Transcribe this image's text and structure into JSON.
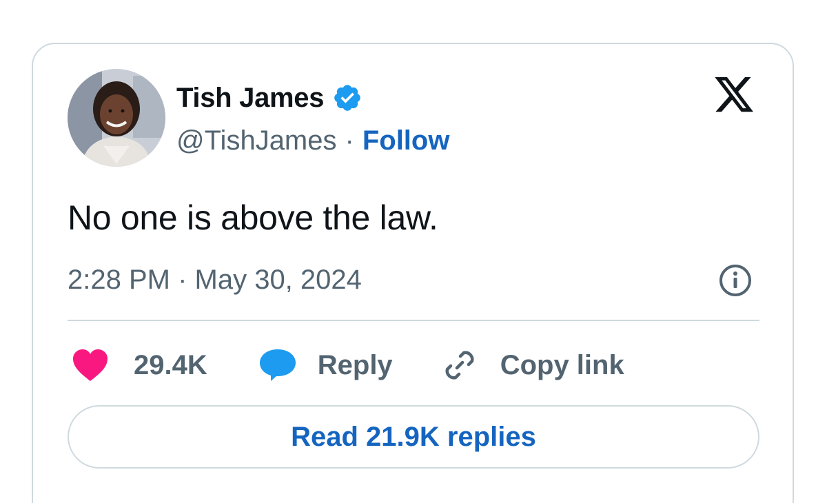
{
  "tweet": {
    "author_name": "Tish James",
    "handle": "@TishJames",
    "separator": "·",
    "follow_label": "Follow",
    "text": "No one is above the law.",
    "timestamp": "2:28 PM · May 30, 2024",
    "likes": "29.4K",
    "reply_label": "Reply",
    "copy_link_label": "Copy link",
    "read_replies_label": "Read 21.9K replies"
  },
  "icons": {
    "verified": "verified-badge-icon",
    "logo": "x-logo-icon",
    "info": "info-icon",
    "like": "heart-icon",
    "reply": "speech-bubble-icon",
    "copy_link": "link-icon"
  },
  "colors": {
    "link_blue": "#1565c0",
    "verified_blue": "#1d9bf0",
    "heart_pink": "#f91880",
    "text_primary": "#0f1419",
    "text_secondary": "#536471",
    "border": "#cfd9de"
  }
}
